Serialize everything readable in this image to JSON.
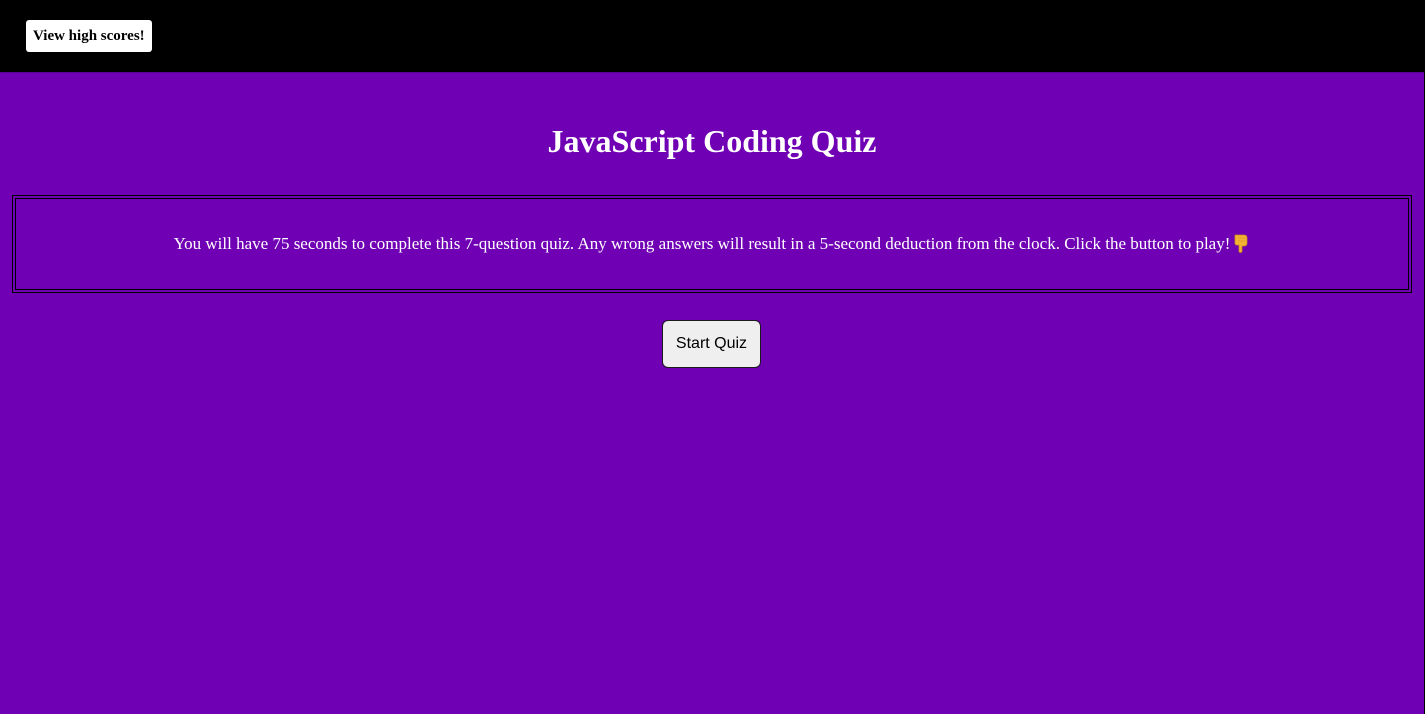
{
  "header": {
    "high_scores_label": "View high scores!"
  },
  "main": {
    "title": "JavaScript Coding Quiz",
    "instructions": "You will have 75 seconds to complete this 7-question quiz. Any wrong answers will result in a 5-second deduction from the clock. Click the button to play!",
    "instructions_icon": "pointing-down-icon",
    "start_label": "Start Quiz"
  },
  "colors": {
    "background": "#6f00b3",
    "header": "#000000",
    "text": "#ffffff"
  }
}
